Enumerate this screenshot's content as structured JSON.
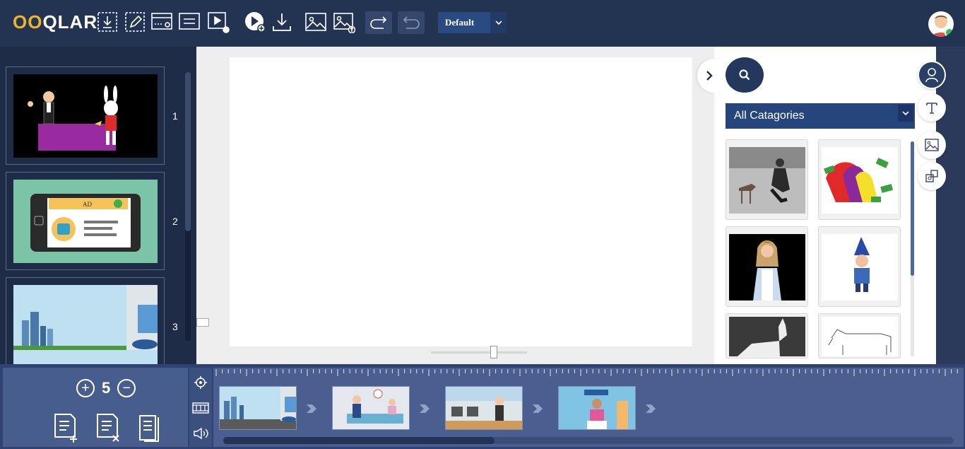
{
  "app": {
    "logo_prefix": "OO",
    "logo_suffix": "QLAR"
  },
  "toolbar": {
    "preset_label": "Default",
    "icons": [
      "import-icon",
      "edit-icon",
      "layout-settings-icon",
      "align-icon",
      "playback-settings-icon",
      "play-add-icon",
      "download-icon",
      "image-icon",
      "image-upload-icon",
      "redo-icon",
      "undo-icon"
    ]
  },
  "slides": [
    {
      "number": "1",
      "scene": "magician-rabbit"
    },
    {
      "number": "2",
      "scene": "tablet-ad",
      "ad_label": "AD"
    },
    {
      "number": "3",
      "scene": "city-street"
    }
  ],
  "assets": {
    "category": "All Catagories",
    "items": [
      "woman-feeding-deer",
      "money-rainbow",
      "woman-presenter",
      "garden-gnome",
      "white-horse",
      "cow-sketch"
    ]
  },
  "rightbar": {
    "icons": [
      "user-icon",
      "text-icon",
      "image-icon",
      "shapes-icon"
    ]
  },
  "timeline": {
    "count": "5",
    "scenes": [
      "city-street",
      "office-desk",
      "office-meeting",
      "news-presenter"
    ],
    "tools": [
      "target-icon",
      "film-icon",
      "audio-icon"
    ]
  },
  "colors": {
    "topbar": "#233352",
    "accent": "#26457d",
    "timeline": "#2f4272"
  }
}
